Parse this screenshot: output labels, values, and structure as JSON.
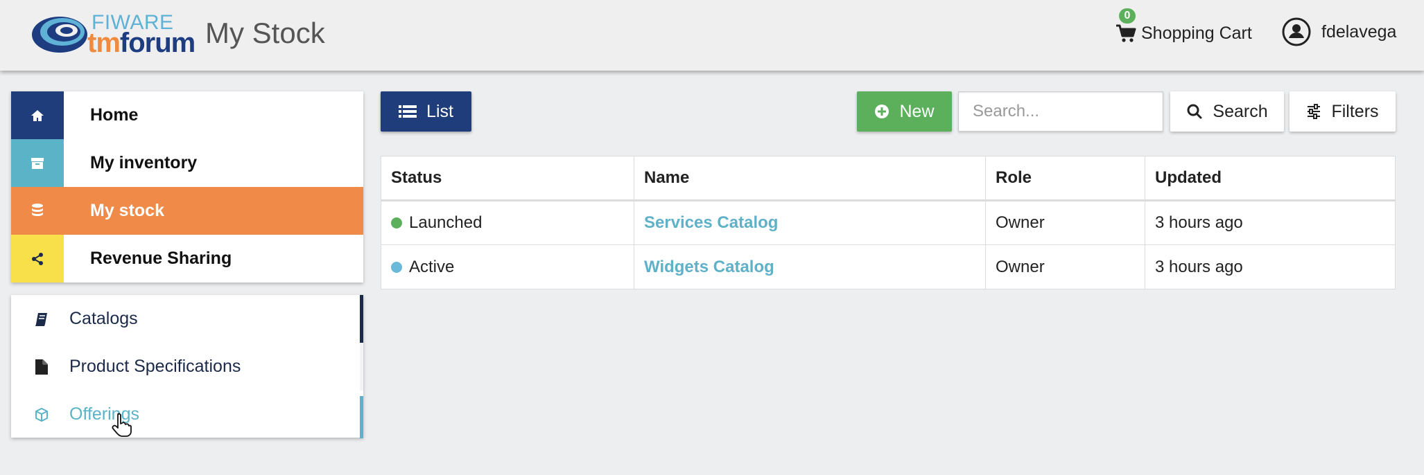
{
  "header": {
    "logo_top": "FIWARE",
    "logo_tm": "tm",
    "logo_forum": "forum",
    "title": "My Stock",
    "cart_count": "0",
    "cart_label": "Shopping Cart",
    "username": "fdelavega"
  },
  "nav": {
    "items": [
      {
        "label": "Home",
        "icon": "home-icon",
        "color": "#1f3d7a"
      },
      {
        "label": "My inventory",
        "icon": "archive-icon",
        "color": "#5ab3c7"
      },
      {
        "label": "My stock",
        "icon": "database-icon",
        "color": "#ef8a48"
      },
      {
        "label": "Revenue Sharing",
        "icon": "share-icon",
        "color": "#f8e04a"
      }
    ],
    "active": "My stock"
  },
  "subnav": {
    "items": [
      {
        "label": "Catalogs",
        "icon": "book-icon"
      },
      {
        "label": "Product Specifications",
        "icon": "file-icon"
      },
      {
        "label": "Offerings",
        "icon": "cube-icon"
      }
    ]
  },
  "toolbar": {
    "list_label": "List",
    "new_label": "New",
    "search_placeholder": "Search...",
    "search_label": "Search",
    "filters_label": "Filters"
  },
  "table": {
    "headers": [
      "Status",
      "Name",
      "Role",
      "Updated"
    ],
    "rows": [
      {
        "status": "Launched",
        "status_color": "#5cb05c",
        "name": "Services Catalog",
        "role": "Owner",
        "updated": "3 hours ago"
      },
      {
        "status": "Active",
        "status_color": "#6bb9d8",
        "name": "Widgets Catalog",
        "role": "Owner",
        "updated": "3 hours ago"
      }
    ]
  },
  "colors": {
    "primary": "#1f3d7a",
    "accent": "#ef8a48",
    "success": "#5cb05c",
    "info": "#5ab3c7"
  }
}
